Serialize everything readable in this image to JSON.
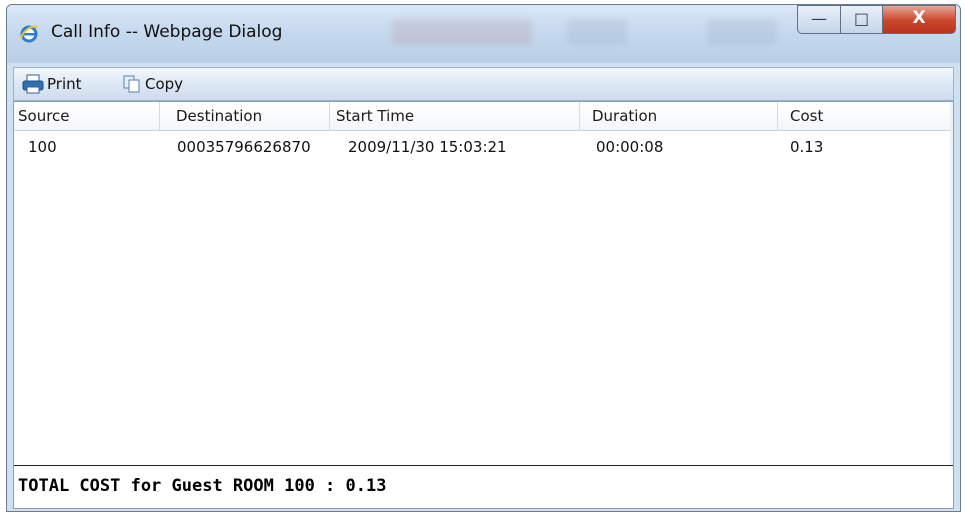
{
  "window": {
    "title": "Call Info -- Webpage Dialog",
    "icon": "ie-icon",
    "controls": {
      "minimize": "—",
      "maximize": "□",
      "close": "X"
    }
  },
  "toolbar": {
    "print_label": "Print",
    "copy_label": "Copy"
  },
  "table": {
    "columns": [
      "Source",
      "Destination",
      "Start Time",
      "Duration",
      "Cost"
    ],
    "rows": [
      [
        "100",
        "00035796626870",
        "2009/11/30 15:03:21",
        "00:00:08",
        "0.13"
      ]
    ]
  },
  "footer": {
    "total_text": "TOTAL COST for Guest ROOM 100 : 0.13"
  },
  "colors": {
    "titlebar": "#c6d9ee",
    "close_button": "#c9462a",
    "toolbar": "#dde8f5"
  }
}
